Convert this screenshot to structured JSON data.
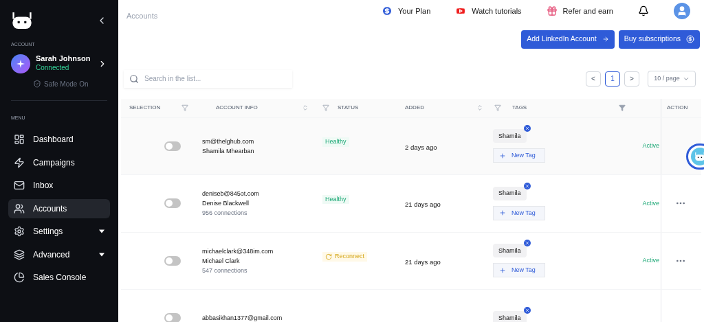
{
  "sidebar": {
    "section_account": "ACCOUNT",
    "account": {
      "name": "Sarah Johnson",
      "status": "Connected",
      "safe_mode": "Safe Mode On"
    },
    "section_menu": "MENU",
    "items": [
      {
        "label": "Dashboard",
        "selected": false,
        "has_submenu": false
      },
      {
        "label": "Campaigns",
        "selected": false,
        "has_submenu": false
      },
      {
        "label": "Inbox",
        "selected": false,
        "has_submenu": false
      },
      {
        "label": "Accounts",
        "selected": true,
        "has_submenu": false
      },
      {
        "label": "Settings",
        "selected": false,
        "has_submenu": true
      },
      {
        "label": "Advanced",
        "selected": false,
        "has_submenu": true
      },
      {
        "label": "Sales Console",
        "selected": false,
        "has_submenu": false
      }
    ]
  },
  "header": {
    "title": "Accounts",
    "links": [
      {
        "label": "Your Plan"
      },
      {
        "label": "Watch tutorials"
      },
      {
        "label": "Refer and earn"
      }
    ]
  },
  "actions": [
    {
      "label": "Add LinkedIn Account"
    },
    {
      "label": "Buy subscriptions"
    }
  ],
  "search": {
    "placeholder": "Search in the list..."
  },
  "pagination": {
    "prev": "<",
    "page": "1",
    "next": ">",
    "page_size": "10 / page"
  },
  "table": {
    "columns": [
      "SELECTION",
      "ACCOUNT INFO",
      "STATUS",
      "ADDED",
      "TAGS",
      "ACTION"
    ],
    "rows": [
      {
        "on": false,
        "email": "sm@thelghub.com",
        "name": "Shamila Mhearban",
        "connections": null,
        "status": {
          "kind": "healthy",
          "label": "Healthy"
        },
        "added": "2 days ago",
        "tag": "Shamila",
        "new_tag": "New Tag",
        "column_6": "Active",
        "menu": false
      },
      {
        "on": false,
        "email": "deniseb@845ot.com",
        "name": "Denise Blackwell",
        "connections": "956 connections",
        "status": {
          "kind": "healthy",
          "label": "Healthy"
        },
        "added": "21 days ago",
        "tag": "Shamila",
        "new_tag": "New Tag",
        "column_6": "Active",
        "menu": true
      },
      {
        "on": false,
        "email": "michaelclark@348im.com",
        "name": "Michael Clark",
        "connections": "547 connections",
        "status": {
          "kind": "reconnect",
          "label": "Reconnect"
        },
        "added": "21 days ago",
        "tag": "Shamila",
        "new_tag": "New Tag",
        "column_6": "Active",
        "menu": true
      },
      {
        "on": false,
        "email": "abbasikhan1377@gmail.com",
        "name": null,
        "connections": null,
        "status": null,
        "added": null,
        "tag": "Shamila",
        "new_tag": null,
        "column_6": null,
        "menu": false
      }
    ]
  }
}
